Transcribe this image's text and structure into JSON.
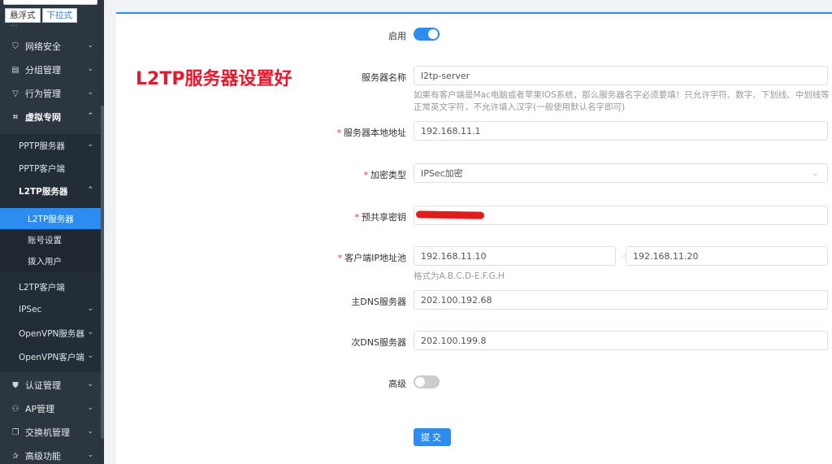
{
  "sidebar": {
    "toggle": {
      "float_label": "悬浮式",
      "dropdown_label": "下拉式"
    },
    "partial_text": "···",
    "items": [
      {
        "label": "网络安全",
        "icon": "shield-icon"
      },
      {
        "label": "分组管理",
        "icon": "document-icon"
      },
      {
        "label": "行为管理",
        "icon": "filter-icon"
      },
      {
        "label": "虚拟专网",
        "icon": "vpn-icon"
      }
    ],
    "vpn_sub": [
      {
        "label": "PPTP服务器"
      },
      {
        "label": "PPTP客户端"
      },
      {
        "label": "L2TP服务器"
      }
    ],
    "l2tp_sub": [
      {
        "label": "L2TP服务器"
      },
      {
        "label": "账号设置"
      },
      {
        "label": "拨入用户"
      }
    ],
    "vpn_sub2": [
      {
        "label": "L2TP客户端"
      },
      {
        "label": "IPSec"
      },
      {
        "label": "OpenVPN服务器"
      },
      {
        "label": "OpenVPN客户端"
      }
    ],
    "bottom_items": [
      {
        "label": "认证管理",
        "icon": "shield-check-icon"
      },
      {
        "label": "AP管理",
        "icon": "network-icon"
      },
      {
        "label": "交换机管理",
        "icon": "switch-icon"
      },
      {
        "label": "高级功能",
        "icon": "pin-icon"
      }
    ],
    "icons": {
      "chevron_down": "⌄",
      "chevron_up": "⌃"
    }
  },
  "main": {
    "annotation": "L2TP服务器设置好",
    "enable": {
      "label": "启用",
      "state": true
    },
    "server_name": {
      "label": "服务器名称",
      "value": "l2tp-server",
      "hint": "如果有客户端是Mac电脑或者苹果IOS系统，那么服务器名字必须要填！只允许字符、数字、下划线、中划线等正常英文字符，不允许填入汉字(一般使用默认名字即可)"
    },
    "local_addr": {
      "label": "服务器本地地址",
      "value": "192.168.11.1"
    },
    "encryption": {
      "label": "加密类型",
      "value": "IPSec加密"
    },
    "psk": {
      "label": "预共享密钥"
    },
    "pool": {
      "label": "客户端IP地址池",
      "start": "192.168.11.10",
      "dash": "-",
      "end": "192.168.11.20",
      "hint": "格式为A.B.C.D-E.F.G.H"
    },
    "dns1": {
      "label": "主DNS服务器",
      "value": "202.100.192.68"
    },
    "dns2": {
      "label": "次DNS服务器",
      "value": "202.100.199.8"
    },
    "advanced": {
      "label": "高级",
      "state": false
    },
    "required_mark": "*",
    "submit_label": "提交",
    "colors": {
      "accent": "#2d8cf0",
      "required": "#e4393c",
      "annotation": "#e4192d"
    }
  }
}
